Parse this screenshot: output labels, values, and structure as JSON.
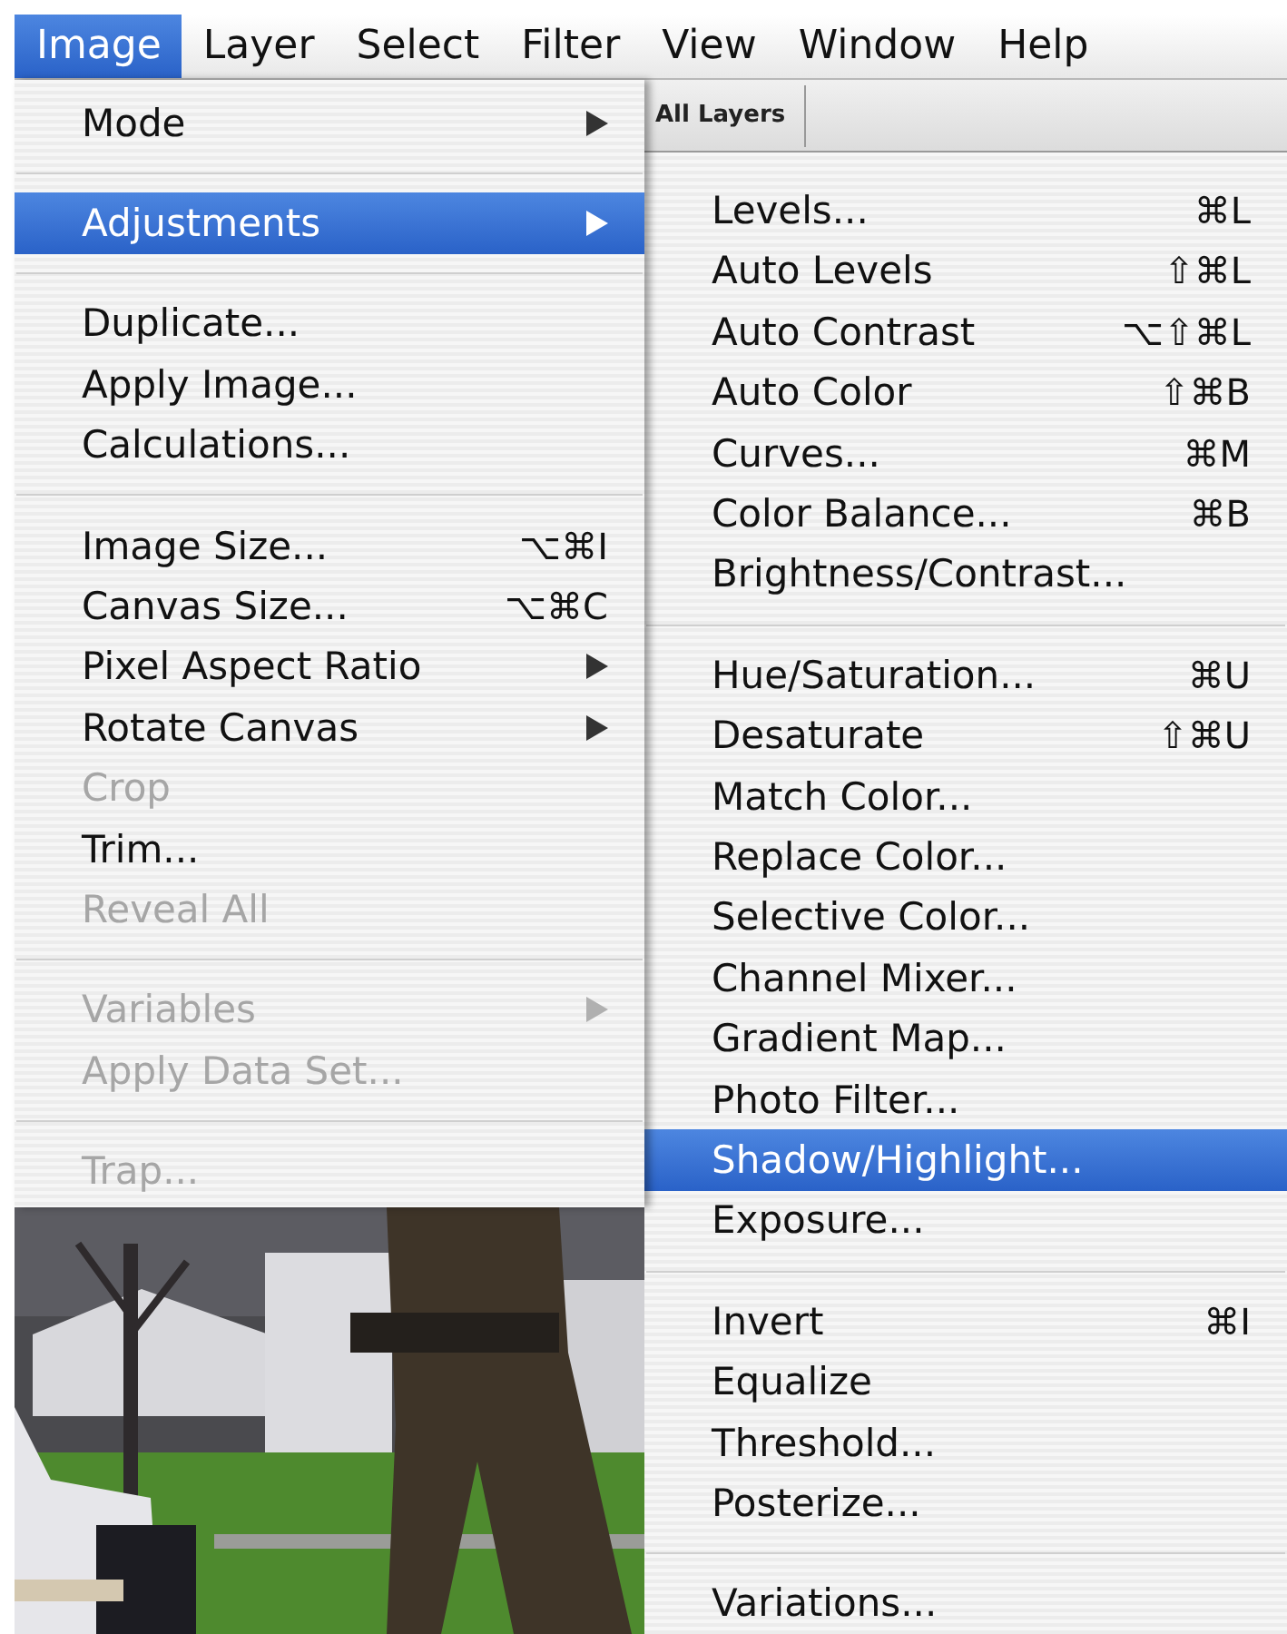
{
  "menubar": [
    {
      "label": "Image",
      "selected": true
    },
    {
      "label": "Layer",
      "selected": false
    },
    {
      "label": "Select",
      "selected": false
    },
    {
      "label": "Filter",
      "selected": false
    },
    {
      "label": "View",
      "selected": false
    },
    {
      "label": "Window",
      "selected": false
    },
    {
      "label": "Help",
      "selected": false
    }
  ],
  "toolbar": {
    "label": "All Layers"
  },
  "image_menu": {
    "items": [
      {
        "kind": "item",
        "label": "Mode",
        "submenu": true,
        "disabled": false,
        "selected": false
      },
      {
        "kind": "separator"
      },
      {
        "kind": "item",
        "label": "Adjustments",
        "submenu": true,
        "disabled": false,
        "selected": true
      },
      {
        "kind": "separator"
      },
      {
        "kind": "item",
        "label": "Duplicate...",
        "submenu": false,
        "disabled": false,
        "selected": false
      },
      {
        "kind": "item",
        "label": "Apply Image...",
        "submenu": false,
        "disabled": false,
        "selected": false
      },
      {
        "kind": "item",
        "label": "Calculations...",
        "submenu": false,
        "disabled": false,
        "selected": false
      },
      {
        "kind": "separator"
      },
      {
        "kind": "item",
        "label": "Image Size...",
        "shortcut": "⌥⌘I",
        "submenu": false,
        "disabled": false,
        "selected": false
      },
      {
        "kind": "item",
        "label": "Canvas Size...",
        "shortcut": "⌥⌘C",
        "submenu": false,
        "disabled": false,
        "selected": false
      },
      {
        "kind": "item",
        "label": "Pixel Aspect Ratio",
        "submenu": true,
        "disabled": false,
        "selected": false
      },
      {
        "kind": "item",
        "label": "Rotate Canvas",
        "submenu": true,
        "disabled": false,
        "selected": false
      },
      {
        "kind": "item",
        "label": "Crop",
        "submenu": false,
        "disabled": true,
        "selected": false
      },
      {
        "kind": "item",
        "label": "Trim...",
        "submenu": false,
        "disabled": false,
        "selected": false
      },
      {
        "kind": "item",
        "label": "Reveal All",
        "submenu": false,
        "disabled": true,
        "selected": false
      },
      {
        "kind": "separator"
      },
      {
        "kind": "item",
        "label": "Variables",
        "submenu": true,
        "disabled": true,
        "selected": false
      },
      {
        "kind": "item",
        "label": "Apply Data Set...",
        "submenu": false,
        "disabled": true,
        "selected": false
      },
      {
        "kind": "separator"
      },
      {
        "kind": "item",
        "label": "Trap...",
        "submenu": false,
        "disabled": true,
        "selected": false
      }
    ]
  },
  "adjustments_submenu": {
    "items": [
      {
        "kind": "item",
        "label": "Levels...",
        "shortcut": "⌘L",
        "selected": false
      },
      {
        "kind": "item",
        "label": "Auto Levels",
        "shortcut": "⇧⌘L",
        "selected": false
      },
      {
        "kind": "item",
        "label": "Auto Contrast",
        "shortcut": "⌥⇧⌘L",
        "selected": false
      },
      {
        "kind": "item",
        "label": "Auto Color",
        "shortcut": "⇧⌘B",
        "selected": false
      },
      {
        "kind": "item",
        "label": "Curves...",
        "shortcut": "⌘M",
        "selected": false
      },
      {
        "kind": "item",
        "label": "Color Balance...",
        "shortcut": "⌘B",
        "selected": false
      },
      {
        "kind": "item",
        "label": "Brightness/Contrast...",
        "selected": false
      },
      {
        "kind": "separator"
      },
      {
        "kind": "item",
        "label": "Hue/Saturation...",
        "shortcut": "⌘U",
        "selected": false
      },
      {
        "kind": "item",
        "label": "Desaturate",
        "shortcut": "⇧⌘U",
        "selected": false
      },
      {
        "kind": "item",
        "label": "Match Color...",
        "selected": false
      },
      {
        "kind": "item",
        "label": "Replace Color...",
        "selected": false
      },
      {
        "kind": "item",
        "label": "Selective Color...",
        "selected": false
      },
      {
        "kind": "item",
        "label": "Channel Mixer...",
        "selected": false
      },
      {
        "kind": "item",
        "label": "Gradient Map...",
        "selected": false
      },
      {
        "kind": "item",
        "label": "Photo Filter...",
        "selected": false
      },
      {
        "kind": "item",
        "label": "Shadow/Highlight...",
        "selected": true
      },
      {
        "kind": "item",
        "label": "Exposure...",
        "selected": false
      },
      {
        "kind": "separator"
      },
      {
        "kind": "item",
        "label": "Invert",
        "shortcut": "⌘I",
        "selected": false
      },
      {
        "kind": "item",
        "label": "Equalize",
        "selected": false
      },
      {
        "kind": "item",
        "label": "Threshold...",
        "selected": false
      },
      {
        "kind": "item",
        "label": "Posterize...",
        "selected": false
      },
      {
        "kind": "separator"
      },
      {
        "kind": "item",
        "label": "Variations...",
        "selected": false
      }
    ]
  }
}
